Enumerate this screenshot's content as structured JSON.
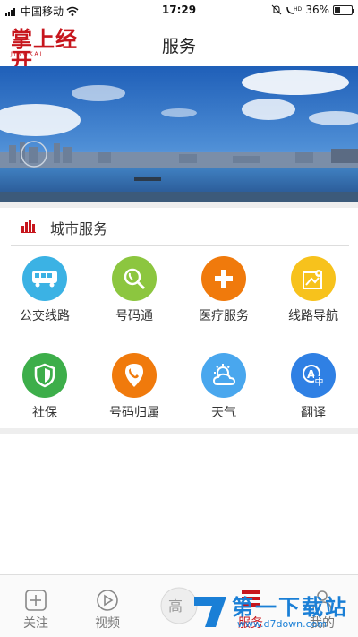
{
  "status_bar": {
    "carrier": "中国移动",
    "time": "17:29",
    "battery": "36%",
    "battery_level": 0.36
  },
  "header": {
    "logo_text": "掌上经开",
    "logo_sub": "JINGKAI",
    "title": "服务"
  },
  "banner": {
    "image": "city-skyline-over-river"
  },
  "section": {
    "title": "城市服务",
    "icon": "city-skyline-icon"
  },
  "services": [
    {
      "label": "公交线路",
      "icon": "bus-icon",
      "color": "#3bb2e4"
    },
    {
      "label": "号码通",
      "icon": "phone-search-icon",
      "color": "#8cc63f"
    },
    {
      "label": "医疗服务",
      "icon": "medical-cross-icon",
      "color": "#f07a0c"
    },
    {
      "label": "线路导航",
      "icon": "map-navigation-icon",
      "color": "#f7c21c"
    },
    {
      "label": "社保",
      "icon": "shield-icon",
      "color": "#3dae4a"
    },
    {
      "label": "号码归属",
      "icon": "phone-location-icon",
      "color": "#f07a0c"
    },
    {
      "label": "天气",
      "icon": "weather-icon",
      "color": "#49a7ee"
    },
    {
      "label": "翻译",
      "icon": "translate-icon",
      "color": "#2f80e4"
    }
  ],
  "tabs": [
    {
      "label": "关注",
      "icon": "add-follow-icon"
    },
    {
      "label": "视频",
      "icon": "play-icon"
    },
    {
      "label": "",
      "icon": "center-logo-icon"
    },
    {
      "label": "服务",
      "icon": "service-grid-icon"
    },
    {
      "label": "我的",
      "icon": "user-icon"
    }
  ],
  "watermark": {
    "text": "第一下载站",
    "url": "www.d7down.com"
  },
  "colors": {
    "brand_red": "#c7161d",
    "watermark_blue": "#1a7fd6"
  }
}
